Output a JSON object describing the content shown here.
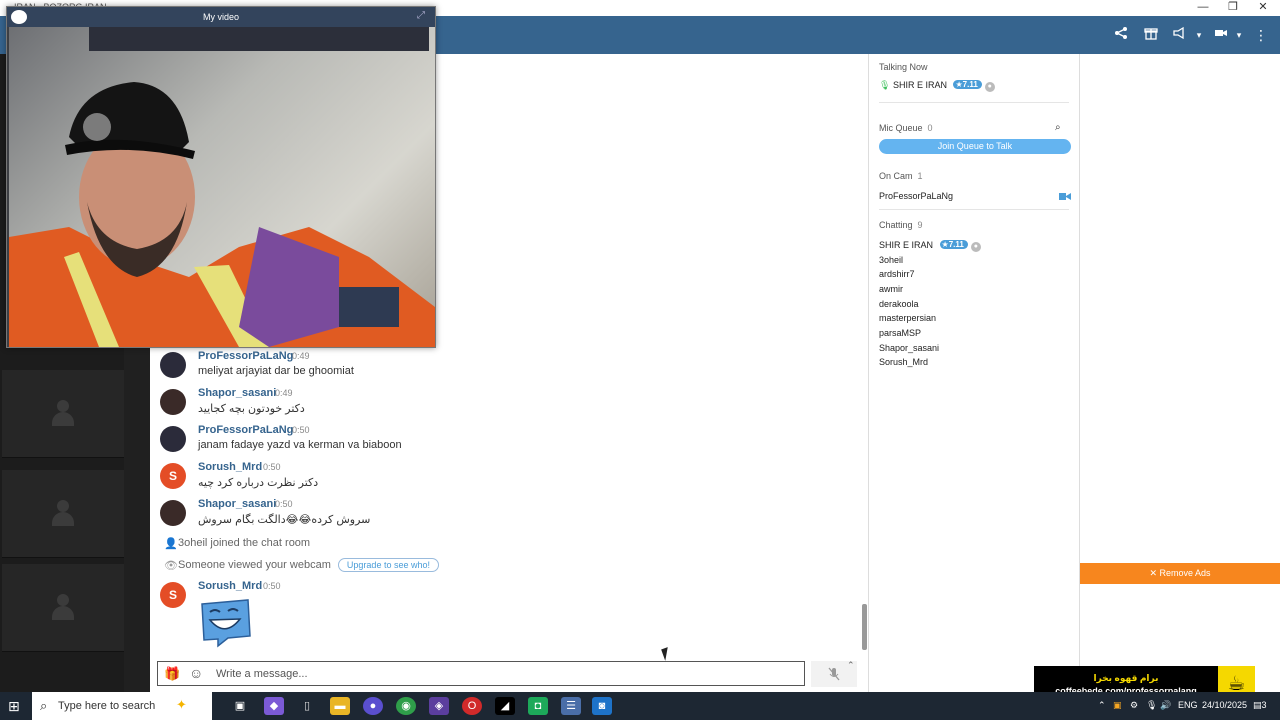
{
  "titlebar": {
    "title": "IRAN - BOZORG IRAN",
    "minimize": "—",
    "restore": "❐",
    "close": "✕"
  },
  "video": {
    "title": "My video"
  },
  "chat": {
    "messages": [
      {
        "user": "ProFessorPaLaNg",
        "time": "0:49",
        "text": "meliyat arjayiat dar be ghoomiat",
        "avatar": "photo"
      },
      {
        "user": "Shapor_sasani",
        "time": "0:49",
        "text": "دکتر خودتون بچه کجایید",
        "avatar": "photo"
      },
      {
        "user": "ProFessorPaLaNg",
        "time": "0:50",
        "text": "janam fadaye yazd va kerman va biaboon",
        "avatar": "photo"
      },
      {
        "user": "Sorush_Mrd",
        "time": "0:50",
        "text": "دکتر نظرت درباره کرد چیه",
        "avatar": "S"
      },
      {
        "user": "Shapor_sasani",
        "time": "0:50",
        "text": "سروش کرده😂😂دالگت بگام سروش",
        "avatar": "photo"
      },
      {
        "user": "Sorush_Mrd",
        "time": "0:50",
        "text": "",
        "avatar": "S"
      }
    ],
    "system": {
      "joined": "3oheil joined the chat room",
      "viewed": "Someone viewed your webcam",
      "upgrade": "Upgrade to see who!"
    },
    "input_placeholder": "Write a message..."
  },
  "sidebar": {
    "talking_now": {
      "label": "Talking Now",
      "user": "SHIR E IRAN",
      "badge": "7.11"
    },
    "mic_queue": {
      "label": "Mic Queue",
      "count": "0",
      "join": "Join Queue to Talk"
    },
    "on_cam": {
      "label": "On Cam",
      "count": "1",
      "user": "ProFessorPaLaNg"
    },
    "chatting": {
      "label": "Chatting",
      "count": "9",
      "first_user": "SHIR E IRAN",
      "first_badge": "7.11",
      "users": [
        "3oheil",
        "ardshirr7",
        "awmir",
        "derakoola",
        "masterpersian",
        "parsaMSP",
        "Shapor_sasani",
        "Sorush_Mrd"
      ]
    }
  },
  "ads": {
    "remove": "✕ Remove Ads",
    "promo_line1": "برام قهوه بخرا",
    "promo_line2": "coffeebede.com/professorpalang"
  },
  "taskbar": {
    "search": "Type here to search",
    "lang": "ENG",
    "date": "24/10/2025",
    "notif": "3"
  }
}
